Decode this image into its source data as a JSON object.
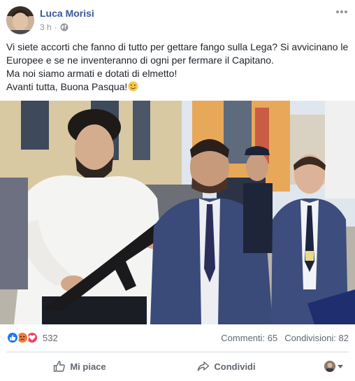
{
  "post": {
    "author": "Luca Morisi",
    "time": "3 h",
    "privacy_icon": "globe-icon",
    "menu_icon": "more-options-icon",
    "text_lines": [
      "Vi siete accorti che fanno di tutto per gettare fango sulla Lega? Si avvicinano le",
      "Europee e se ne inventeranno di ogni per fermare il Capitano.",
      "Ma noi siamo armati e dotati di elmetto!",
      "Avanti tutta, Buona Pasqua!"
    ],
    "emoji": "winking-face-icon",
    "photo_icon": "post-photo"
  },
  "stats": {
    "reaction_icons": [
      "like-reaction-icon",
      "angry-reaction-icon",
      "love-reaction-icon"
    ],
    "reaction_count": "532",
    "comments": "Commenti: 65",
    "shares": "Condivisioni: 82"
  },
  "actions": {
    "like": "Mi piace",
    "share": "Condividi"
  },
  "colors": {
    "author": "#365899",
    "meta": "#90949c",
    "text": "#1d2129",
    "action": "#606770",
    "like_blue": "#1877f2",
    "love_red": "#f33e58",
    "angry_orange": "#f7b125"
  }
}
